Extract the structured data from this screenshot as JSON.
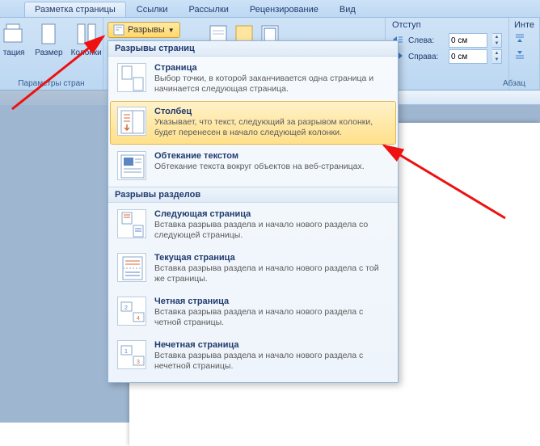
{
  "tabs": {
    "layout": "Разметка страницы",
    "links": "Ссылки",
    "mailings": "Рассылки",
    "review": "Рецензирование",
    "view": "Вид"
  },
  "ribbon": {
    "orientation": "тация",
    "size": "Размер",
    "columns": "Колонки",
    "page_setup_group": "Параметры стран",
    "breaks_button": "Разрывы",
    "indent": {
      "title": "Отступ",
      "left_label": "Слева:",
      "left_value": "0 см",
      "right_label": "Справа:",
      "right_value": "0 см"
    },
    "spacing_title": "Инте",
    "paragraph_group": "Абзац"
  },
  "menu": {
    "section_page": "Разрывы страниц",
    "item_page": {
      "title": "Страница",
      "desc": "Выбор точки, в которой заканчивается одна страница и начинается следующая страница."
    },
    "item_column": {
      "title": "Столбец",
      "desc": "Указывает, что текст, следующий за разрывом колонки, будет перенесен в начало следующей колонки."
    },
    "item_textwrap": {
      "title": "Обтекание текстом",
      "desc": "Обтекание текста вокруг объектов на веб-страницах."
    },
    "section_section": "Разрывы разделов",
    "item_nextpage": {
      "title": "Следующая страница",
      "desc": "Вставка разрыва раздела и начало нового раздела со следующей страницы."
    },
    "item_continuous": {
      "title": "Текущая страница",
      "desc": "Вставка разрыва раздела и начало нового раздела с той же страницы."
    },
    "item_even": {
      "title": "Четная страница",
      "desc": "Вставка разрыва раздела и начало нового раздела с четной страницы."
    },
    "item_odd": {
      "title": "Нечетная страница",
      "desc": "Вставка разрыва раздела и начало нового раздела с нечетной страницы."
    }
  }
}
